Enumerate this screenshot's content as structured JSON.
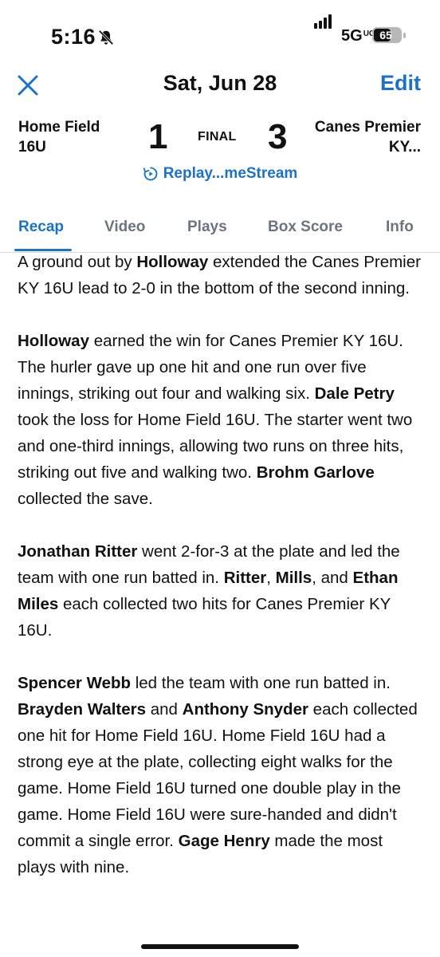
{
  "status_bar": {
    "time": "5:16",
    "network": "5G",
    "network_sup": "UC",
    "battery": "65"
  },
  "nav": {
    "title": "Sat, Jun 28",
    "edit_label": "Edit"
  },
  "game": {
    "home_team": "Home Field 16U",
    "home_score": "1",
    "status": "FINAL",
    "away_score": "3",
    "away_team": "Canes Premier KY...",
    "replay_label": "Replay...meStream"
  },
  "tabs": [
    {
      "label": "Recap"
    },
    {
      "label": "Video"
    },
    {
      "label": "Plays"
    },
    {
      "label": "Box Score"
    },
    {
      "label": "Info"
    }
  ],
  "recap": {
    "p1": {
      "t0": "A ground out by ",
      "b0": "Holloway",
      "t1": " extended the Canes Premier KY 16U lead to 2-0 in the bottom of the second inning."
    },
    "p2": {
      "b0": "Holloway",
      "t0": " earned the win for Canes Premier KY 16U. The hurler gave up one hit and one run over five innings, striking out four and walking six. ",
      "b1": "Dale Petry",
      "t1": " took the loss for Home Field 16U. The starter went two and one-third innings, allowing two runs on three hits, striking out five and walking two. ",
      "b2": "Brohm Garlove",
      "t2": " collected the save."
    },
    "p3": {
      "b0": "Jonathan Ritter",
      "t0": " went 2-for-3 at the plate and led the team with one run batted in. ",
      "b1": "Ritter",
      "t1": ", ",
      "b2": "Mills",
      "t2": ", and ",
      "b3": "Ethan Miles",
      "t3": " each collected two hits for Canes Premier KY 16U."
    },
    "p4": {
      "b0": "Spencer Webb",
      "t0": " led the team with one run batted in. ",
      "b1": "Brayden Walters",
      "t1": " and ",
      "b2": "Anthony Snyder",
      "t2": " each collected one hit for Home Field 16U. Home Field 16U had a strong eye at the plate, collecting eight walks for the game. Home Field 16U turned one double play in the game. Home Field 16U were sure-handed and didn't commit a single error. ",
      "b3": "Gage Henry",
      "t3": " made the most plays with nine."
    }
  }
}
